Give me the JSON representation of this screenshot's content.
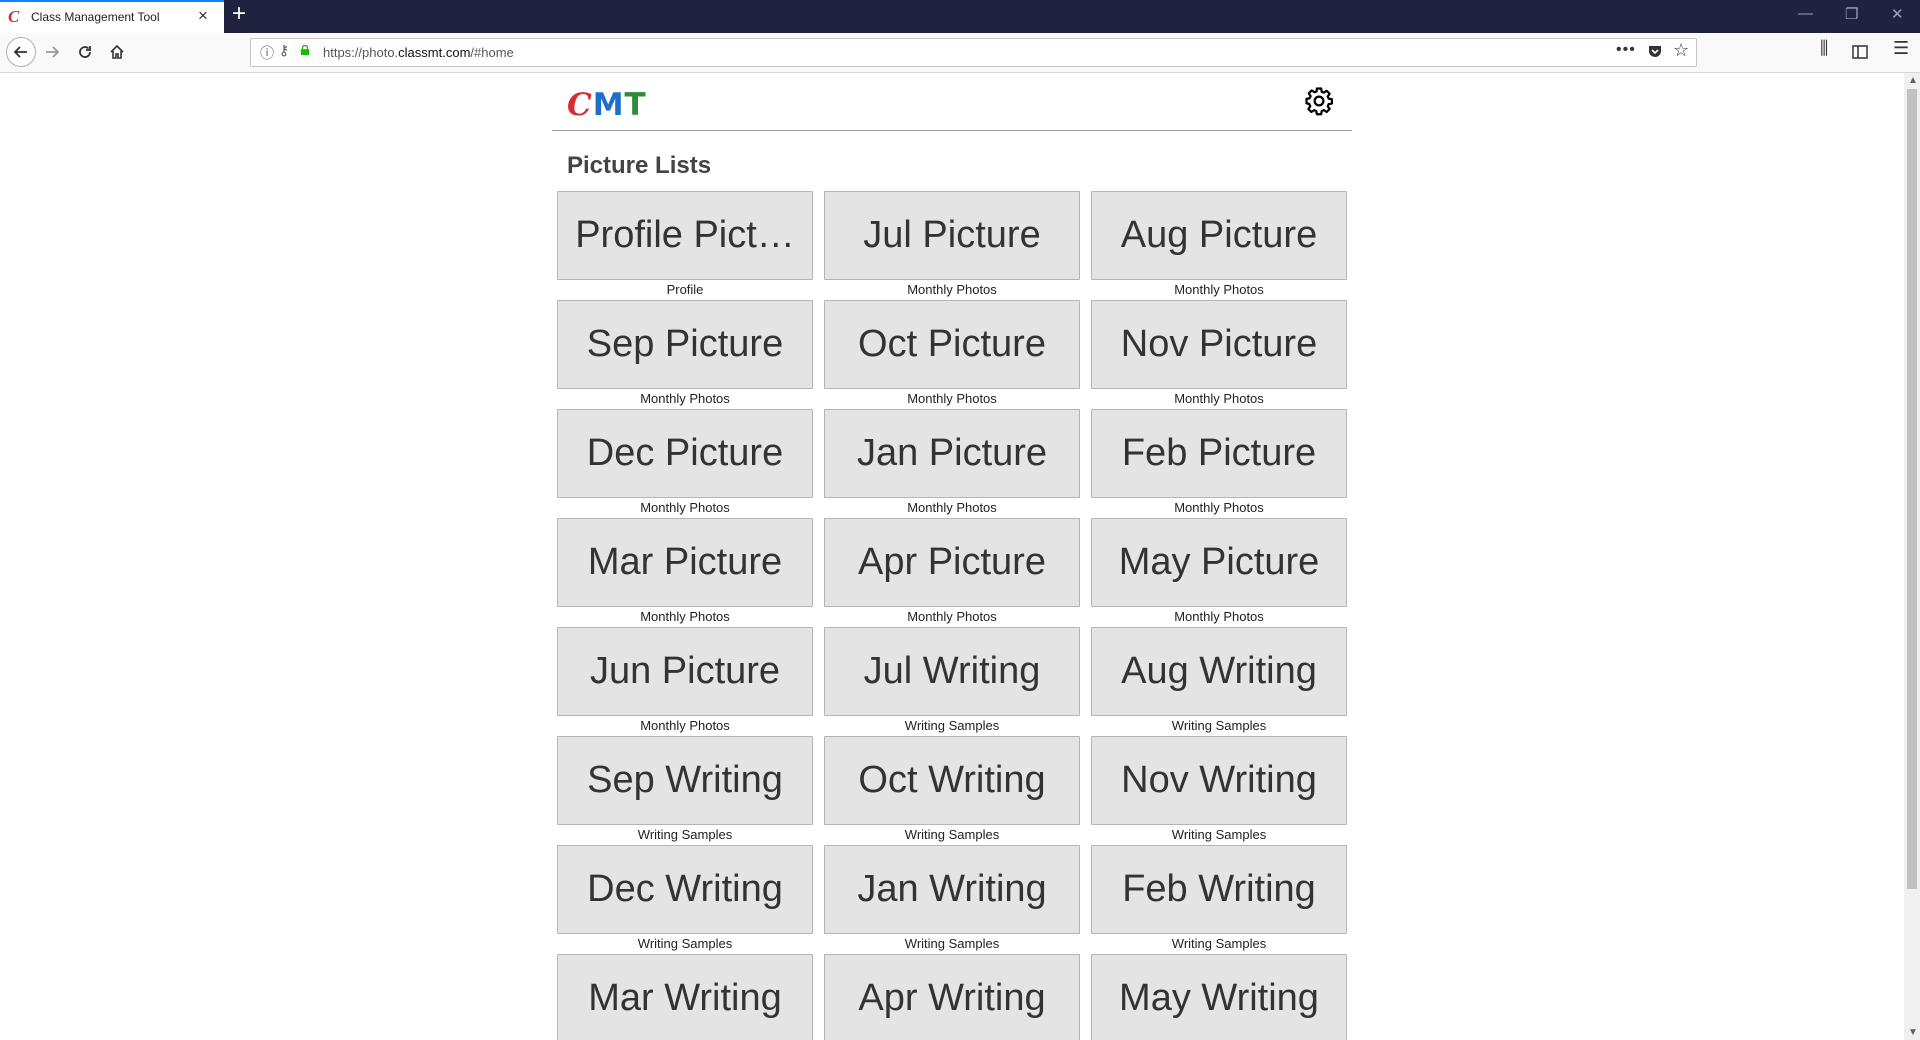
{
  "browser": {
    "tab_title": "Class Management Tool",
    "tab_favicon": "C",
    "url_host_prefix": "https://photo.",
    "url_domain": "classmt.com",
    "url_path": "/#home"
  },
  "icons": {
    "back": "back-arrow-icon",
    "forward": "forward-arrow-icon",
    "reload": "reload-icon",
    "home": "home-icon",
    "settings": "gear-icon",
    "lock": "lock-icon"
  },
  "header": {
    "logo_c": "C",
    "logo_m": "M",
    "logo_t": "T"
  },
  "main": {
    "section_title": "Picture Lists"
  },
  "lists": [
    {
      "label": "Profile Pict…",
      "subtitle": "Profile"
    },
    {
      "label": "Jul Picture",
      "subtitle": "Monthly Photos"
    },
    {
      "label": "Aug Picture",
      "subtitle": "Monthly Photos"
    },
    {
      "label": "Sep Picture",
      "subtitle": "Monthly Photos"
    },
    {
      "label": "Oct Picture",
      "subtitle": "Monthly Photos"
    },
    {
      "label": "Nov Picture",
      "subtitle": "Monthly Photos"
    },
    {
      "label": "Dec Picture",
      "subtitle": "Monthly Photos"
    },
    {
      "label": "Jan Picture",
      "subtitle": "Monthly Photos"
    },
    {
      "label": "Feb Picture",
      "subtitle": "Monthly Photos"
    },
    {
      "label": "Mar Picture",
      "subtitle": "Monthly Photos"
    },
    {
      "label": "Apr Picture",
      "subtitle": "Monthly Photos"
    },
    {
      "label": "May Picture",
      "subtitle": "Monthly Photos"
    },
    {
      "label": "Jun Picture",
      "subtitle": "Monthly Photos"
    },
    {
      "label": "Jul Writing",
      "subtitle": "Writing Samples"
    },
    {
      "label": "Aug Writing",
      "subtitle": "Writing Samples"
    },
    {
      "label": "Sep Writing",
      "subtitle": "Writing Samples"
    },
    {
      "label": "Oct Writing",
      "subtitle": "Writing Samples"
    },
    {
      "label": "Nov Writing",
      "subtitle": "Writing Samples"
    },
    {
      "label": "Dec Writing",
      "subtitle": "Writing Samples"
    },
    {
      "label": "Jan Writing",
      "subtitle": "Writing Samples"
    },
    {
      "label": "Feb Writing",
      "subtitle": "Writing Samples"
    },
    {
      "label": "Mar Writing",
      "subtitle": ""
    },
    {
      "label": "Apr Writing",
      "subtitle": ""
    },
    {
      "label": "May Writing",
      "subtitle": ""
    }
  ],
  "colors": {
    "logo_c": "#d32f2f",
    "logo_m": "#1e6fc9",
    "logo_t": "#2e8b3a",
    "card_bg": "#e4e4e4",
    "tabbar_bg": "#202340"
  }
}
